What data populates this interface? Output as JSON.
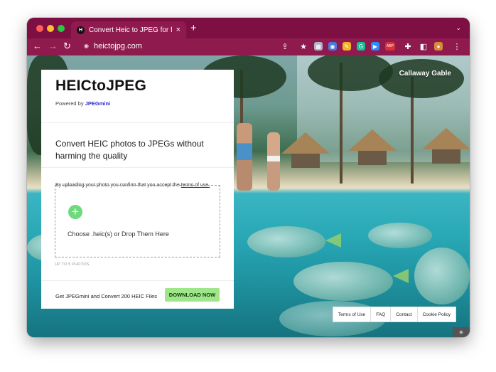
{
  "browser": {
    "tab_title": "Convert Heic to JPEG for free |",
    "tab_favicon": "H",
    "tab_close": "×",
    "new_tab": "+",
    "tab_menu": "⌄",
    "url": "heictojpg.com",
    "nav": {
      "back": "←",
      "forward": "→",
      "reload": "↻"
    },
    "extensions": [
      {
        "name": "share-icon",
        "glyph": "⇪",
        "color": "transparent"
      },
      {
        "name": "bookmark-star-icon",
        "glyph": "★",
        "color": "transparent"
      },
      {
        "name": "extension-grid-icon",
        "glyph": "▦",
        "color": "#b3b3c8"
      },
      {
        "name": "extension-globe-icon",
        "glyph": "◉",
        "color": "#4a78e0"
      },
      {
        "name": "extension-pen-icon",
        "glyph": "✎",
        "color": "#f2b52a"
      },
      {
        "name": "grammarly-icon",
        "glyph": "G",
        "color": "#15c39a"
      },
      {
        "name": "zoom-icon",
        "glyph": "▶",
        "color": "#2d8cff"
      },
      {
        "name": "adblock-icon",
        "glyph": "ABP",
        "color": "#d9303a"
      },
      {
        "name": "extensions-puzzle-icon",
        "glyph": "✚",
        "color": "transparent"
      },
      {
        "name": "sidebar-icon",
        "glyph": "◧",
        "color": "transparent"
      },
      {
        "name": "profile-avatar-icon",
        "glyph": "●",
        "color": "#d98a3a"
      },
      {
        "name": "menu-dots-icon",
        "glyph": "⋮",
        "color": "transparent"
      }
    ]
  },
  "page": {
    "photo_credit": "Callaway Gable",
    "card": {
      "logo": "HEICtoJPEG",
      "powered_prefix": "Powered by",
      "powered_link": "JPEGmini",
      "tagline": "Convert HEIC photos to JPEGs without harming the quality",
      "consent_prefix": "By uploading your photo you confirm that you accept the",
      "consent_link": "terms of use.",
      "plus": "+",
      "dropzone_text": "Choose .heic(s) or Drop Them Here",
      "upto": "UP TO 5 PHOTOS",
      "footer_text": "Get JPEGmini and Convert 200 HEIC Files",
      "download_label": "DOWNLOAD NOW"
    },
    "footer_links": [
      "Terms of Use",
      "FAQ",
      "Contact",
      "Cookie Policy"
    ],
    "corner_glyph": "✳"
  }
}
